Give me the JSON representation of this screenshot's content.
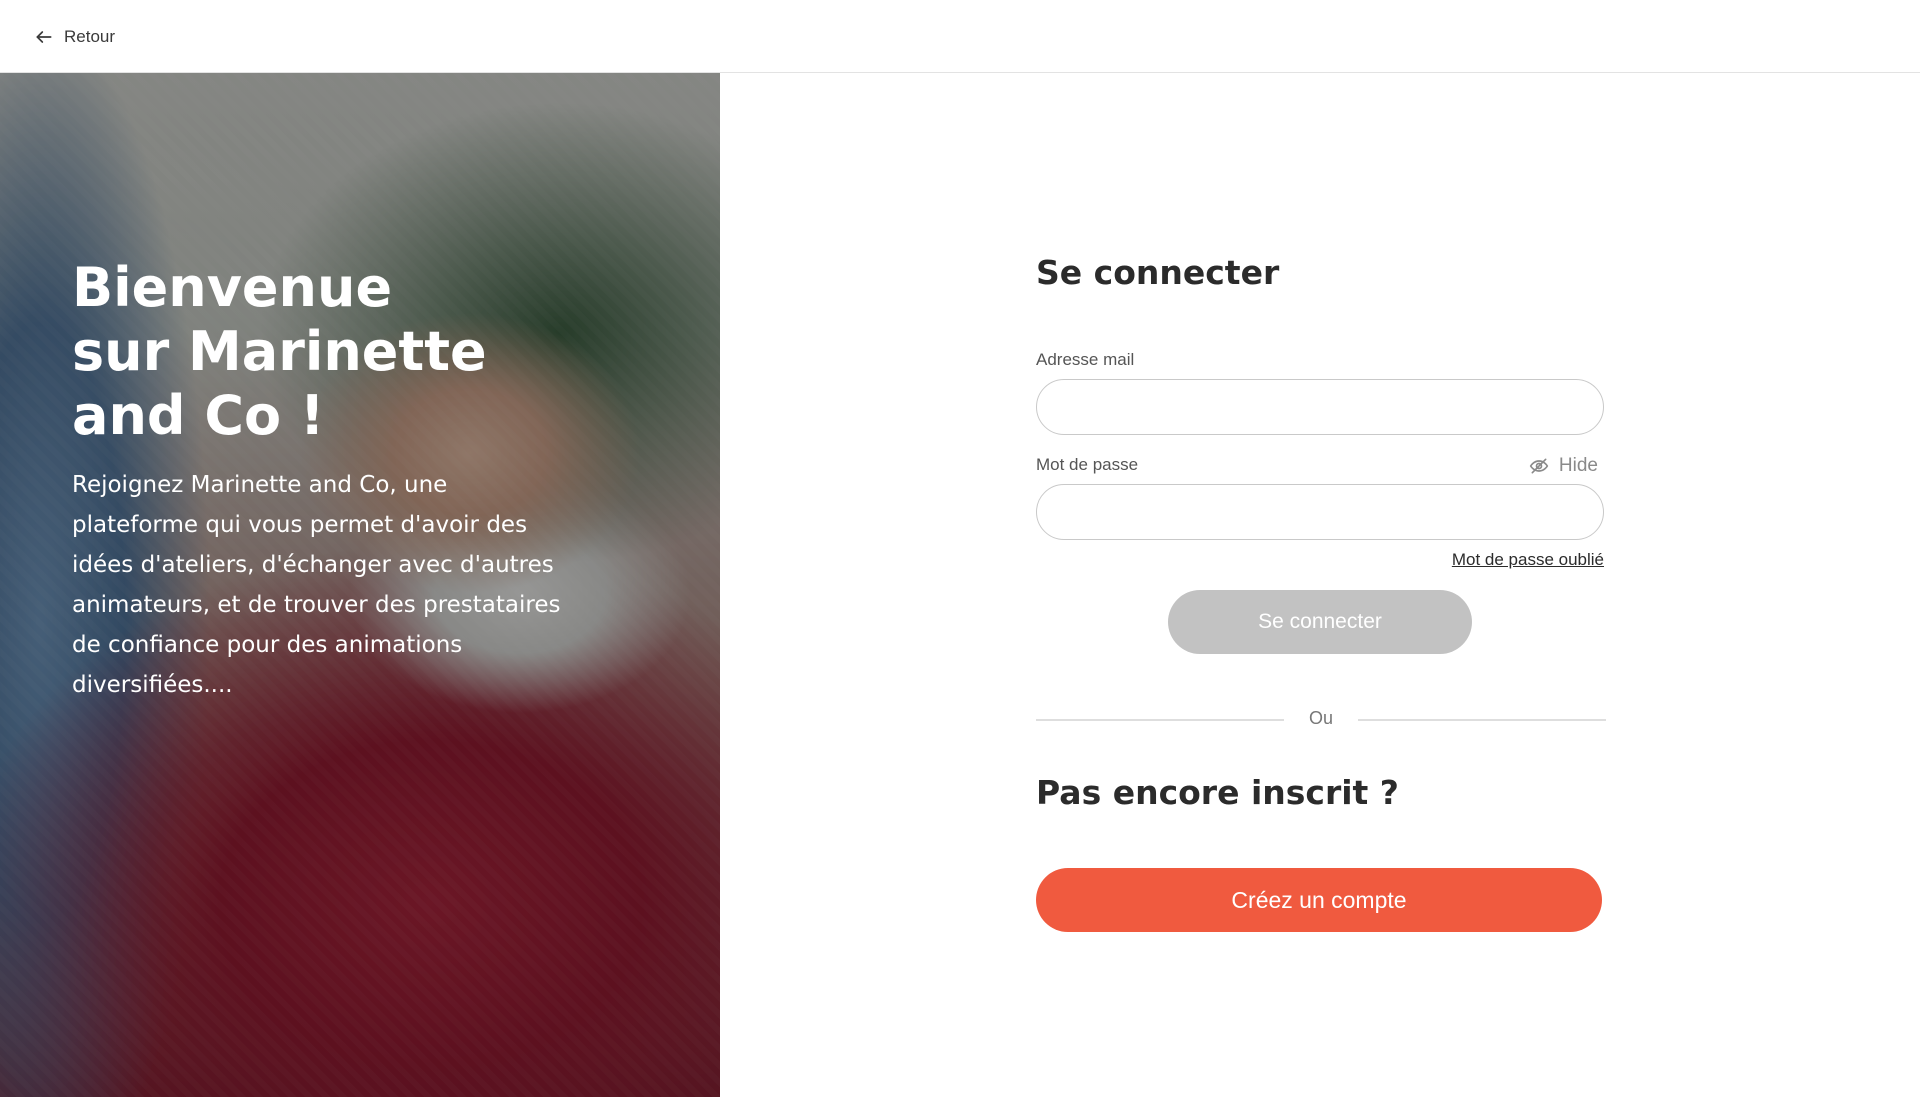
{
  "topbar": {
    "back_label": "Retour",
    "back_icon": "arrow-left-icon"
  },
  "hero": {
    "title": "Bienvenue\nsur Marinette\nand Co !",
    "description": "Rejoignez Marinette and Co, une plateforme qui vous permet d'avoir des idées d'ateliers, d'échanger avec d'autres animateurs, et de trouver des prestataires de confiance pour des animations diversifiées...."
  },
  "login": {
    "title": "Se connecter",
    "email_label": "Adresse mail",
    "email_value": "",
    "password_label": "Mot de passe",
    "password_value": "",
    "hide_label": "Hide",
    "hide_icon": "eye-slash-icon",
    "forgot_label": "Mot de passe oublié",
    "submit_label": "Se connecter"
  },
  "divider": {
    "label": "Ou"
  },
  "signup": {
    "title": "Pas encore inscrit ?",
    "button_label": "Créez un compte"
  },
  "colors": {
    "accent": "#f05a3f",
    "disabled_button": "#c2c2c2",
    "text": "#2b2b2b"
  }
}
